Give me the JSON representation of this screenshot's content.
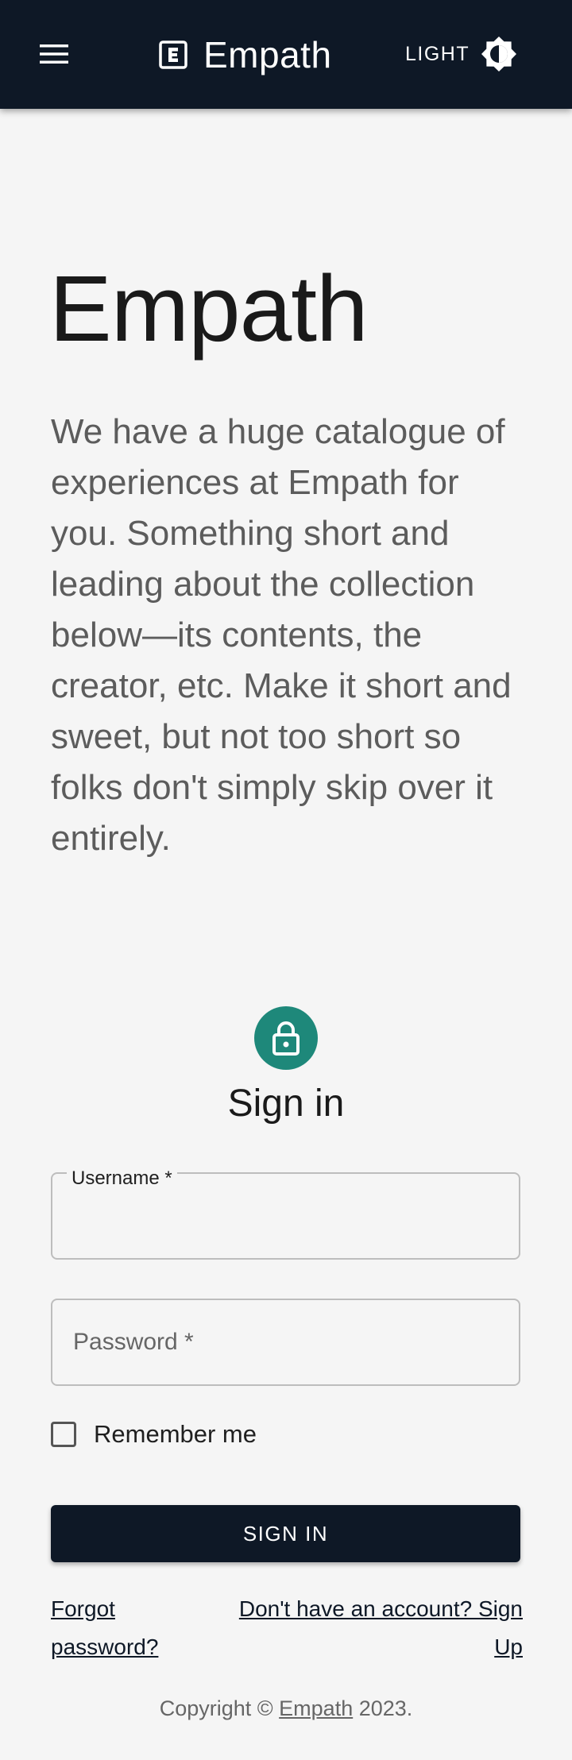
{
  "appbar": {
    "brand": "Empath",
    "theme_label": "LIGHT",
    "icons": {
      "menu": "menu-icon",
      "logo": "letter-e-box-icon",
      "theme": "brightness-icon"
    },
    "colors": {
      "background": "#0e1826",
      "text": "#ffffff"
    }
  },
  "hero": {
    "title": "Empath",
    "description": "We have a huge catalogue of experiences at Empath for you. Something short and leading about the collection below—its contents, the creator, etc. Make it short and sweet, but not too short so folks don't simply skip over it entirely."
  },
  "signin": {
    "icon": "lock-icon",
    "accent_color": "#1e887a",
    "title": "Sign in",
    "username_label": "Username *",
    "username_value": "",
    "password_placeholder": "Password *",
    "remember_label": "Remember me",
    "remember_checked": false,
    "submit_label": "SIGN IN",
    "forgot_line1": "Forgot",
    "forgot_line2": "password?",
    "signup_link": "Don't have an account? Sign Up"
  },
  "footer": {
    "prefix": "Copyright © ",
    "link": "Empath",
    "suffix": " 2023."
  }
}
